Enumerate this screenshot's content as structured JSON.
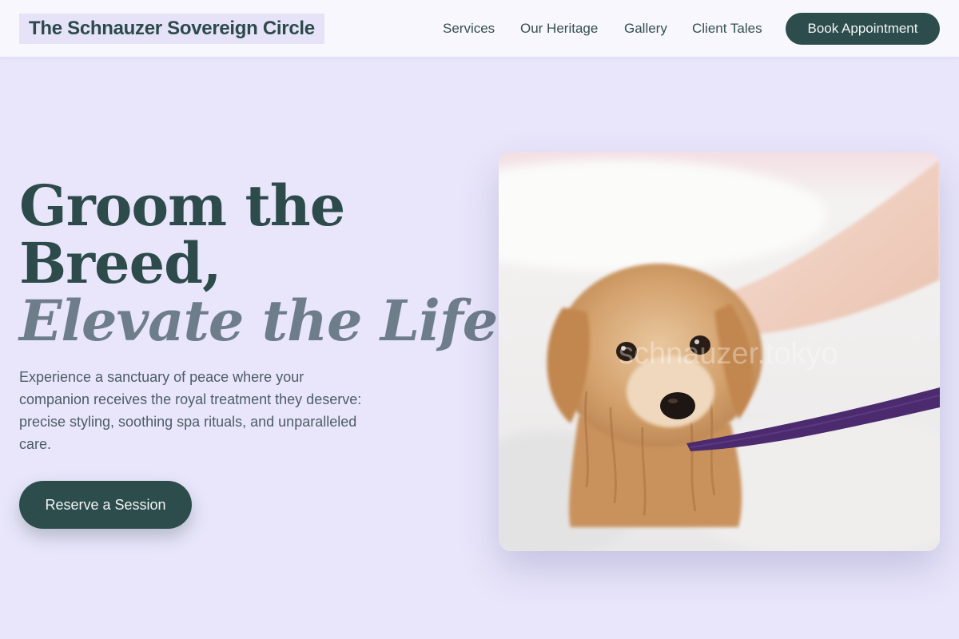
{
  "header": {
    "brand": "The Schnauzer Sovereign Circle",
    "nav": {
      "services": "Services",
      "heritage": "Our Heritage",
      "gallery": "Gallery",
      "tales": "Client Tales"
    },
    "cta": "Book Appointment"
  },
  "hero": {
    "headline_line1": "Groom the",
    "headline_line2": "Breed,",
    "headline_line3": "Elevate the Life.",
    "description": "Experience a sanctuary of peace where your companion receives the royal treatment they deserve: precise styling, soothing spa rituals, and unparalleled care.",
    "cta": "Reserve a Session"
  },
  "photo": {
    "watermark": "schnauzer.tokyo"
  },
  "colors": {
    "background": "#e9e6fb",
    "header_bg": "#f7f7fd",
    "primary": "#2d4d4d",
    "accent_text": "#6e7d8a",
    "leash": "#4b2a6e"
  }
}
